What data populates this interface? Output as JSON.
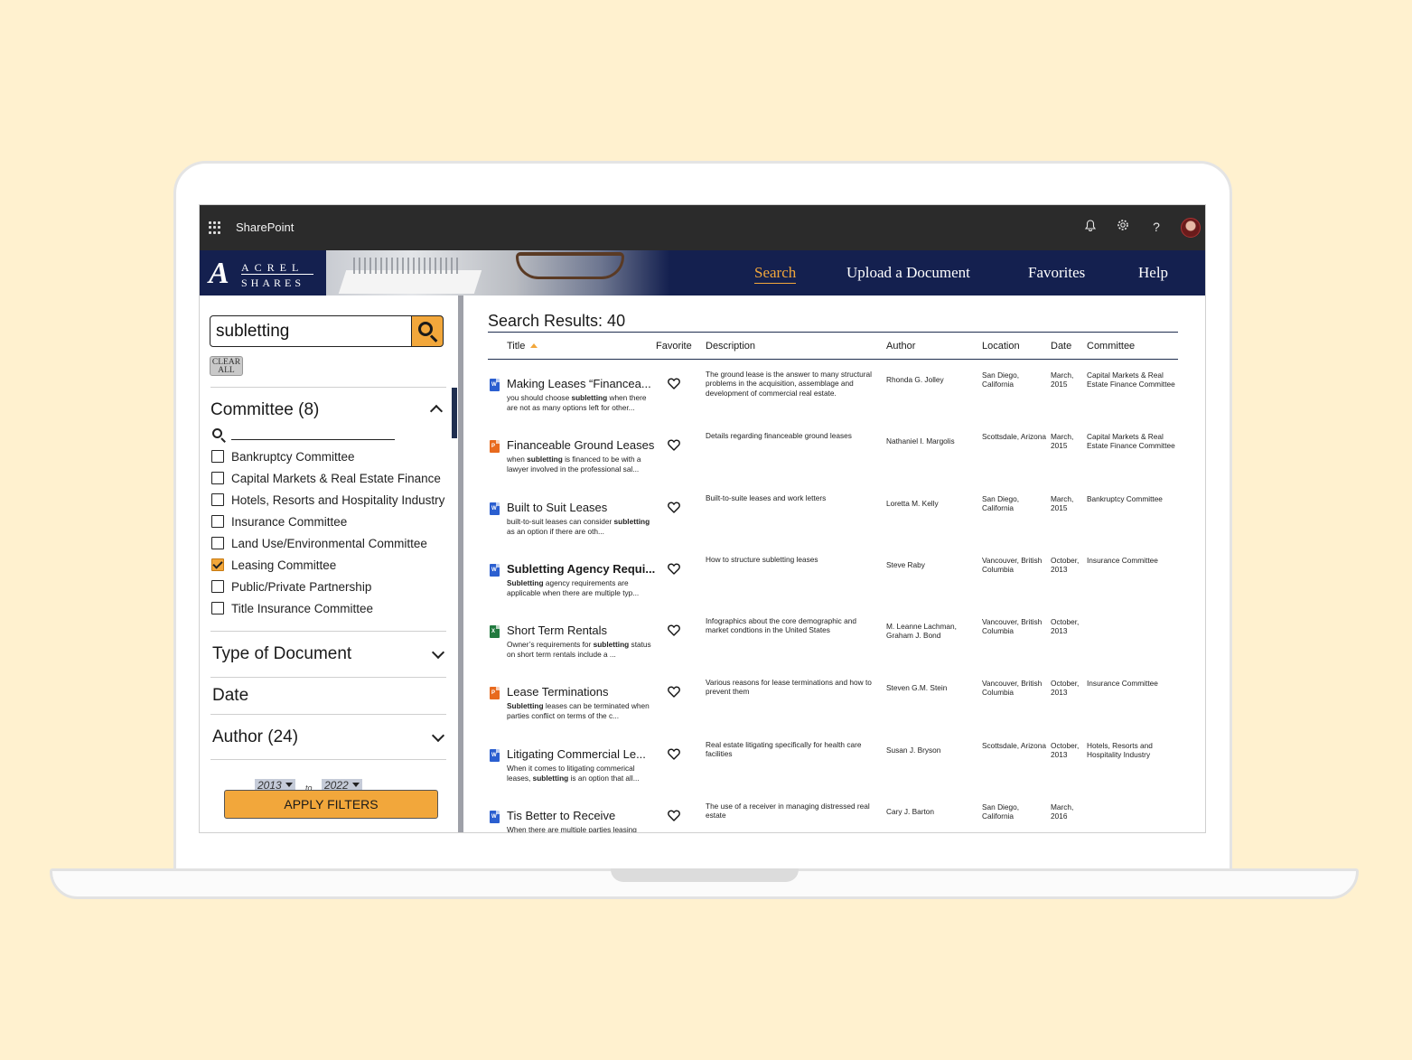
{
  "suite": {
    "title": "SharePoint",
    "icons": [
      "bell-icon",
      "gear-icon",
      "help-icon"
    ],
    "help_glyph": "?"
  },
  "brand": {
    "logo_line1": "ACREL",
    "logo_line2": "SHARES",
    "nav": [
      {
        "label": "Search",
        "active": true
      },
      {
        "label": "Upload a Document",
        "active": false
      },
      {
        "label": "Favorites",
        "active": false
      },
      {
        "label": "Help",
        "active": false
      }
    ],
    "accent": "#f2a73b",
    "navy": "#14204f"
  },
  "filters": {
    "search_value": "subletting",
    "clear_label": "CLEAR ALL",
    "committee_title": "Committee (8)",
    "committees": [
      {
        "label": "Bankruptcy Committee",
        "checked": false
      },
      {
        "label": "Capital Markets & Real Estate Finance",
        "checked": false
      },
      {
        "label": "Hotels, Resorts and Hospitality Industry",
        "checked": false
      },
      {
        "label": "Insurance Committee",
        "checked": false
      },
      {
        "label": "Land Use/Environmental Committee",
        "checked": false
      },
      {
        "label": "Leasing Committee",
        "checked": true
      },
      {
        "label": "Public/Private Partnership",
        "checked": false
      },
      {
        "label": "Title Insurance Committee",
        "checked": false
      }
    ],
    "type_title": "Type of Document",
    "date_title": "Date",
    "date_from": "2013",
    "date_to_label": "to",
    "date_to": "2022",
    "author_title": "Author (24)",
    "apply_label": "APPLY FILTERS"
  },
  "results": {
    "title": "Search Results: 40",
    "columns": [
      "Title",
      "Favorite",
      "Description",
      "Author",
      "Location",
      "Date",
      "Committee"
    ],
    "rows": [
      {
        "type": "word",
        "title": "Making Leases “Financea...",
        "bold": false,
        "snippet_pre": "you should choose ",
        "snippet_kw": "subletting",
        "snippet_post": " when there are not as many options left for other...",
        "description": "The ground lease is the answer to many structural problems in the acquisition, assemblage and development of commercial real estate.",
        "author": "Rhonda G. Jolley",
        "location": "San Diego, California",
        "date": "March, 2015",
        "committee": "Capital Markets & Real Estate Finance Committee"
      },
      {
        "type": "ppt",
        "title": "Financeable Ground Leases",
        "bold": false,
        "snippet_pre": "when ",
        "snippet_kw": "subletting",
        "snippet_post": " is financed to be with a lawyer involved in the professional sal...",
        "description": "Details regarding financeable ground leases",
        "author": "Nathaniel I. Margolis",
        "location": "Scottsdale, Arizona",
        "date": "March, 2015",
        "committee": "Capital Markets & Real Estate Finance Committee"
      },
      {
        "type": "word",
        "title": "Built to Suit Leases",
        "bold": false,
        "snippet_pre": "built-to-suit leases can consider ",
        "snippet_kw": "subletting",
        "snippet_post": " as an option if there are oth...",
        "description": "Built-to-suite leases and work letters",
        "author": "Loretta M. Kelly",
        "location": "San Diego, California",
        "date": "March, 2015",
        "committee": "Bankruptcy Committee"
      },
      {
        "type": "word",
        "title": "Subletting Agency Requi...",
        "bold": true,
        "snippet_pre": "",
        "snippet_kw": "Subletting",
        "snippet_post": " agency requirements are applicable when there are multiple typ...",
        "description": "How to structure subletting leases",
        "author": "Steve Raby",
        "location": "Vancouver, British Columbia",
        "date": "October, 2013",
        "committee": "Insurance Committee"
      },
      {
        "type": "xls",
        "title": "Short Term Rentals",
        "bold": false,
        "snippet_pre": "Owner’s requirements for ",
        "snippet_kw": "subletting",
        "snippet_post": " status on short term rentals include a ...",
        "description": "Infographics about the core demographic and market condtions in the United States",
        "author": "M. Leanne Lachman, Graham J. Bond",
        "location": "Vancouver, British Columbia",
        "date": "October, 2013",
        "committee": ""
      },
      {
        "type": "ppt",
        "title": "Lease Terminations",
        "bold": false,
        "snippet_pre": "",
        "snippet_kw": "Subletting",
        "snippet_post": " leases can be terminated when parties conflict on terms of the c...",
        "description": "Various reasons for lease terminations and how to prevent them",
        "author": "Steven G.M. Stein",
        "location": "Vancouver, British Columbia",
        "date": "October, 2013",
        "committee": "Insurance Committee"
      },
      {
        "type": "word",
        "title": "Litigating Commercial Le...",
        "bold": false,
        "snippet_pre": "When it comes to litigating commerical leases, ",
        "snippet_kw": "subletting",
        "snippet_post": " is an option that all...",
        "description": "Real estate litigating specifically for health care facilities",
        "author": "Susan J. Bryson",
        "location": "Scottsdale, Arizona",
        "date": "October, 2013",
        "committee": "Hotels, Resorts and Hospitality Industry"
      },
      {
        "type": "word",
        "title": "Tis Better to Receive",
        "bold": false,
        "snippet_pre": "When there are multiple parties leasing",
        "snippet_kw": "",
        "snippet_post": "",
        "description": "The use of a receiver in managing distressed real estate",
        "author": "Cary J. Barton",
        "location": "San Diego, California",
        "date": "March, 2016",
        "committee": ""
      }
    ]
  }
}
